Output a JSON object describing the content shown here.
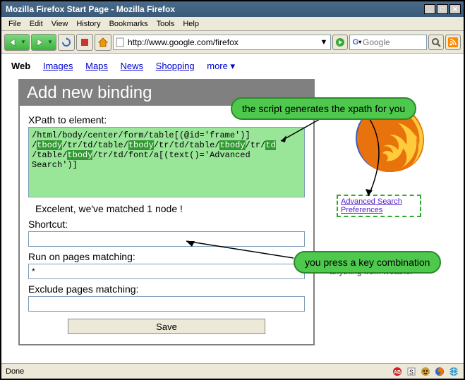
{
  "window": {
    "title": "Mozilla Firefox Start Page - Mozilla Firefox"
  },
  "menu": {
    "file": "File",
    "edit": "Edit",
    "view": "View",
    "history": "History",
    "bookmarks": "Bookmarks",
    "tools": "Tools",
    "help": "Help"
  },
  "toolbar": {
    "url": "http://www.google.com/firefox",
    "search_engine_glyph": "G",
    "search_placeholder": "Google"
  },
  "google_nav": {
    "web": "Web",
    "images": "Images",
    "maps": "Maps",
    "news": "News",
    "shopping": "Shopping",
    "more": "more ▾"
  },
  "panel": {
    "title": "Add new binding",
    "xpath_label": "XPath to element:",
    "xpath_value": "/html/body/center/form/table[(@id='frame')]/tbody/tr/td/table/tbody/tr/td/table/tbody/tr/td/table/tbody/tr/td/font/a[(text()='Advanced Search')]",
    "match_msg": "Excelent, we've matched 1 node !",
    "shortcut_label": "Shortcut:",
    "shortcut_value": "",
    "run_label": "Run on pages matching:",
    "run_value": "*",
    "exclude_label": "Exclude pages matching:",
    "exclude_value": "",
    "save_label": "Save"
  },
  "background": {
    "advanced_search": "Advanced Search",
    "preferences": "Preferences",
    "weather_snippet": "anything from weather"
  },
  "callouts": {
    "c1": "the script generates the xpath for you",
    "c2": "you press a key combination"
  },
  "status": {
    "text": "Done"
  }
}
